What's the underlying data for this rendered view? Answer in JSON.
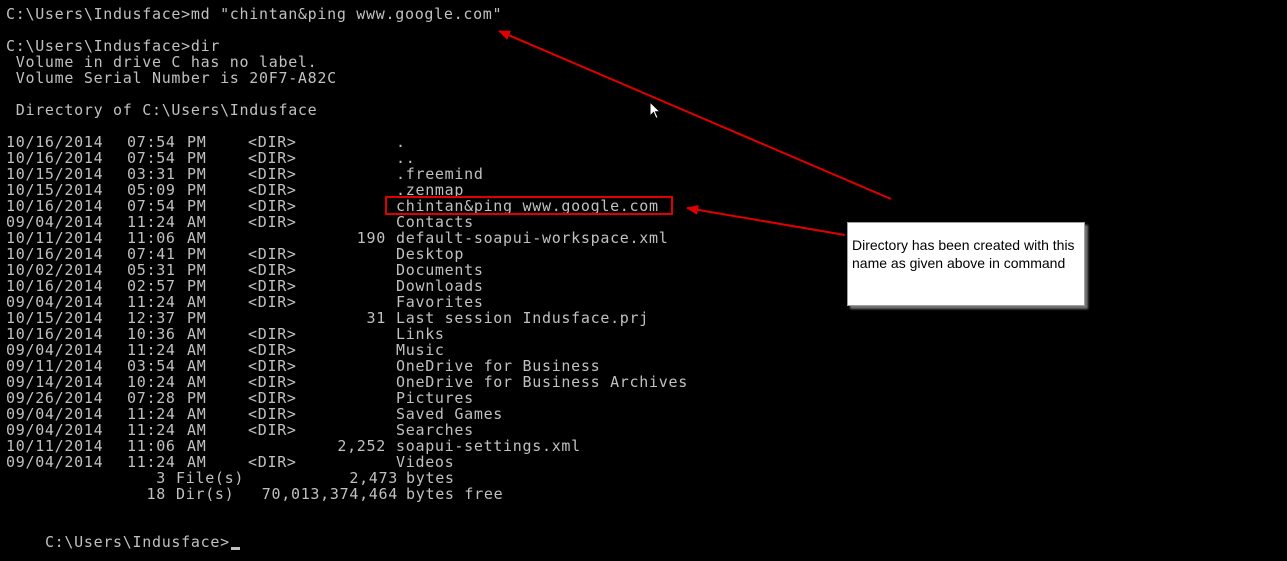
{
  "console": {
    "command_line": "C:\\Users\\Indusface>md \"chintan&ping www.google.com\"",
    "dir_command": "C:\\Users\\Indusface>dir",
    "volume_label": " Volume in drive C has no label.",
    "volume_serial": " Volume Serial Number is 20F7-A82C",
    "directory_of": " Directory of C:\\Users\\Indusface",
    "entries": [
      {
        "date": "10/16/2014",
        "time": "07:54",
        "ampm": "PM",
        "type": "<DIR>",
        "size": "",
        "name": "."
      },
      {
        "date": "10/16/2014",
        "time": "07:54",
        "ampm": "PM",
        "type": "<DIR>",
        "size": "",
        "name": ".."
      },
      {
        "date": "10/15/2014",
        "time": "03:31",
        "ampm": "PM",
        "type": "<DIR>",
        "size": "",
        "name": ".freemind"
      },
      {
        "date": "10/15/2014",
        "time": "05:09",
        "ampm": "PM",
        "type": "<DIR>",
        "size": "",
        "name": ".zenmap"
      },
      {
        "date": "10/16/2014",
        "time": "07:54",
        "ampm": "PM",
        "type": "<DIR>",
        "size": "",
        "name": "chintan&ping www.google.com"
      },
      {
        "date": "09/04/2014",
        "time": "11:24",
        "ampm": "AM",
        "type": "<DIR>",
        "size": "",
        "name": "Contacts"
      },
      {
        "date": "10/11/2014",
        "time": "11:06",
        "ampm": "AM",
        "type": "",
        "size": "190",
        "name": "default-soapui-workspace.xml"
      },
      {
        "date": "10/16/2014",
        "time": "07:41",
        "ampm": "PM",
        "type": "<DIR>",
        "size": "",
        "name": "Desktop"
      },
      {
        "date": "10/02/2014",
        "time": "05:31",
        "ampm": "PM",
        "type": "<DIR>",
        "size": "",
        "name": "Documents"
      },
      {
        "date": "10/16/2014",
        "time": "02:57",
        "ampm": "PM",
        "type": "<DIR>",
        "size": "",
        "name": "Downloads"
      },
      {
        "date": "09/04/2014",
        "time": "11:24",
        "ampm": "AM",
        "type": "<DIR>",
        "size": "",
        "name": "Favorites"
      },
      {
        "date": "10/15/2014",
        "time": "12:37",
        "ampm": "PM",
        "type": "",
        "size": "31",
        "name": "Last session Indusface.prj"
      },
      {
        "date": "10/16/2014",
        "time": "10:36",
        "ampm": "AM",
        "type": "<DIR>",
        "size": "",
        "name": "Links"
      },
      {
        "date": "09/04/2014",
        "time": "11:24",
        "ampm": "AM",
        "type": "<DIR>",
        "size": "",
        "name": "Music"
      },
      {
        "date": "09/11/2014",
        "time": "03:54",
        "ampm": "AM",
        "type": "<DIR>",
        "size": "",
        "name": "OneDrive for Business"
      },
      {
        "date": "09/14/2014",
        "time": "10:24",
        "ampm": "AM",
        "type": "<DIR>",
        "size": "",
        "name": "OneDrive for Business Archives"
      },
      {
        "date": "09/26/2014",
        "time": "07:28",
        "ampm": "PM",
        "type": "<DIR>",
        "size": "",
        "name": "Pictures"
      },
      {
        "date": "09/04/2014",
        "time": "11:24",
        "ampm": "AM",
        "type": "<DIR>",
        "size": "",
        "name": "Saved Games"
      },
      {
        "date": "09/04/2014",
        "time": "11:24",
        "ampm": "AM",
        "type": "<DIR>",
        "size": "",
        "name": "Searches"
      },
      {
        "date": "10/11/2014",
        "time": "11:06",
        "ampm": "AM",
        "type": "",
        "size": "2,252",
        "name": "soapui-settings.xml"
      },
      {
        "date": "09/04/2014",
        "time": "11:24",
        "ampm": "AM",
        "type": "<DIR>",
        "size": "",
        "name": "Videos"
      }
    ],
    "summary_files": {
      "count": "3",
      "label": "File(s)",
      "value": "2,473",
      "unit": "bytes"
    },
    "summary_dirs": {
      "count": "18",
      "label": "Dir(s)",
      "value": "70,013,374,464",
      "unit": "bytes free"
    },
    "final_prompt": "C:\\Users\\Indusface>"
  },
  "annotation": {
    "note_text": "Directory has been created with this name as given above in command"
  },
  "colors": {
    "background": "#000000",
    "console_text": "#c0c0c0",
    "annotation_red": "#e00000",
    "note_background": "#ffffff"
  }
}
